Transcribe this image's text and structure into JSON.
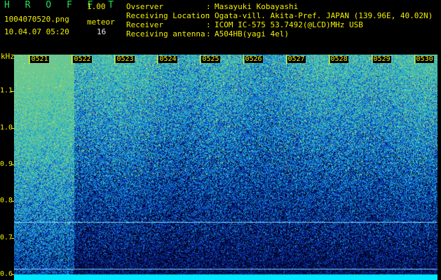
{
  "header": {
    "app_title": "H R O F F T",
    "version": "1.00",
    "filename": "1004070520.png",
    "datetime": "10.04.07 05:20",
    "meteor_label": "meteor",
    "meteor_count": "16"
  },
  "info": [
    {
      "label": "Ovserver",
      "colon": ":",
      "value": "Masayuki Kobayashi"
    },
    {
      "label": "Receiving Location",
      "colon": ":",
      "value": "Ogata-vill. Akita-Pref. JAPAN (139.96E, 40.02N)"
    },
    {
      "label": "Receiver",
      "colon": ":",
      "value": "ICOM IC-575 53.7492(@LCD)MHz USB"
    },
    {
      "label": "Receiving antenna",
      "colon": ":",
      "value": "A504HB(yagi 4el)"
    }
  ],
  "axis": {
    "y_unit": "kHz",
    "y_ticks": [
      "1.1",
      "1.0",
      "0.9",
      "0.8",
      "0.7",
      "0.6"
    ],
    "y_values": [
      1.1,
      1.0,
      0.9,
      0.8,
      0.7,
      0.6
    ],
    "y_range": [
      0.585,
      1.2
    ],
    "x_ticks": [
      "0521",
      "0522",
      "0523",
      "0524",
      "0525",
      "0526",
      "0527",
      "0528",
      "0529",
      "0530"
    ],
    "x_values": [
      521,
      522,
      523,
      524,
      525,
      526,
      527,
      528,
      529,
      530
    ],
    "x_range": [
      520.55,
      530.45
    ]
  },
  "spectrogram": {
    "carrier_lines_khz": [
      0.743,
      0.615,
      0.6
    ],
    "high_activity_minute_range": [
      520.55,
      521.95
    ],
    "colors": {
      "background": "#000000",
      "noise_low": "#0a1a6a",
      "noise_mid": "#1d4fd8",
      "noise_high": "#38c8b0",
      "carrier": "#7fd8ff",
      "baseline": "#00e8ff"
    }
  }
}
